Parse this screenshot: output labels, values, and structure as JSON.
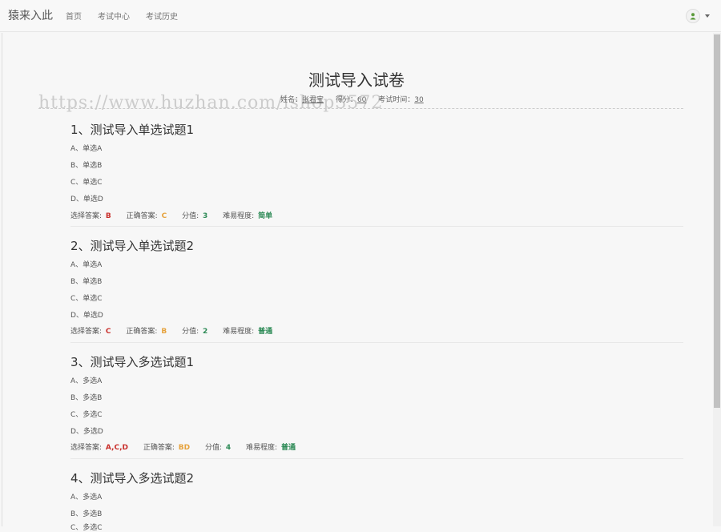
{
  "navbar": {
    "brand": "猿来入此",
    "links": [
      "首页",
      "考试中心",
      "考试历史"
    ]
  },
  "exam": {
    "title": "测试导入试卷",
    "name_label": "姓名：",
    "name": "张君宝",
    "score_label": "得分：",
    "score": "60",
    "time_label": "考试时间：",
    "time": "30"
  },
  "watermark": "https://www.huzhan.com/ishop3572",
  "labels": {
    "selected": "选择答案:",
    "correct": "正确答案:",
    "points": "分值:",
    "difficulty": "难易程度:"
  },
  "questions": [
    {
      "title": "1、测试导入单选试题1",
      "options": [
        "A、单选A",
        "B、单选B",
        "C、单选C",
        "D、单选D"
      ],
      "selected": "B",
      "correct": "C",
      "points": "3",
      "difficulty": "简单"
    },
    {
      "title": "2、测试导入单选试题2",
      "options": [
        "A、单选A",
        "B、单选B",
        "C、单选C",
        "D、单选D"
      ],
      "selected": "C",
      "correct": "B",
      "points": "2",
      "difficulty": "普通"
    },
    {
      "title": "3、测试导入多选试题1",
      "options": [
        "A、多选A",
        "B、多选B",
        "C、多选C",
        "D、多选D"
      ],
      "selected": "A,C,D",
      "correct": "BD",
      "points": "4",
      "difficulty": "普通"
    },
    {
      "title": "4、测试导入多选试题2",
      "options": [
        "A、多选A",
        "B、多选B",
        "C、多选C"
      ]
    }
  ]
}
